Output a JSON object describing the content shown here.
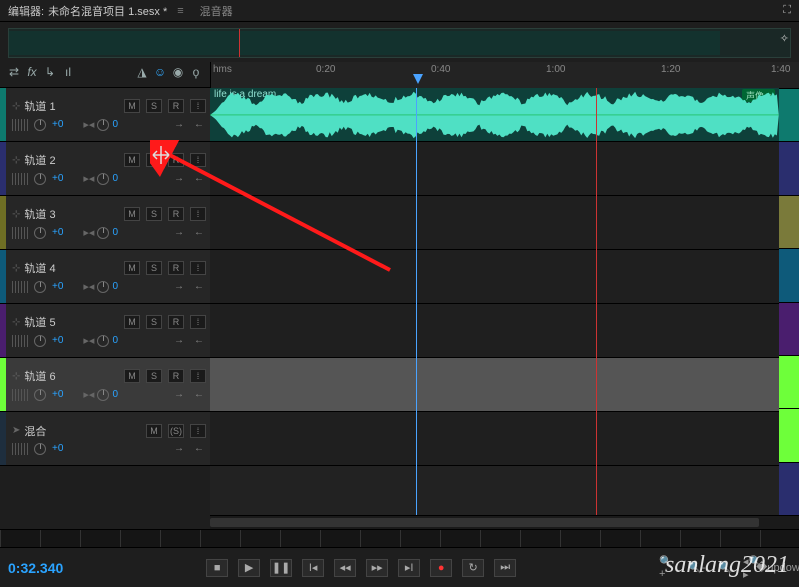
{
  "titlebar": {
    "editor_label": "编辑器:",
    "project_name": "未命名混音项目 1.sesx *",
    "mixer_tab": "混音器"
  },
  "overview": {
    "playhead_pct": 29
  },
  "ruler": {
    "unit": "hms",
    "labels": [
      "0:20",
      "0:40",
      "1:00",
      "1:20",
      "1:40"
    ]
  },
  "tracks": [
    {
      "name": "轨道 1",
      "color": "#0e7a6e",
      "vol": "+0",
      "pan": "0",
      "msr": [
        "M",
        "S",
        "R"
      ],
      "mix": false
    },
    {
      "name": "轨道 2",
      "color": "#2a2e6e",
      "vol": "+0",
      "pan": "0",
      "msr": [
        "M",
        "S",
        "R"
      ],
      "mix": false
    },
    {
      "name": "轨道 3",
      "color": "#6e6e24",
      "vol": "+0",
      "pan": "0",
      "msr": [
        "M",
        "S",
        "R"
      ],
      "mix": false
    },
    {
      "name": "轨道 4",
      "color": "#0e5a7a",
      "vol": "+0",
      "pan": "0",
      "msr": [
        "M",
        "S",
        "R"
      ],
      "mix": false
    },
    {
      "name": "轨道 5",
      "color": "#4a1e6e",
      "vol": "+0",
      "pan": "0",
      "msr": [
        "M",
        "S",
        "R"
      ],
      "mix": false
    },
    {
      "name": "轨道 6",
      "color": "#6eff3a",
      "vol": "+0",
      "pan": "0",
      "msr": [
        "M",
        "S",
        "R"
      ],
      "mix": false,
      "selected": true
    },
    {
      "name": "混合",
      "color": "#1e2e3e",
      "vol": "+0",
      "pan": "",
      "msr": [
        "M",
        "(S)"
      ],
      "mix": true
    }
  ],
  "clip": {
    "name": "life is a dream",
    "pill": "声像 ▾"
  },
  "channel_colors": [
    "#0e7a6e",
    "#2a2e6e",
    "#7a7a3a",
    "#0e5a7a",
    "#4a1e6e",
    "#6eff3a",
    "#6eff3a",
    "#2a2e6e"
  ],
  "transport": {
    "timecode": "0:32.340"
  },
  "watermark": "sanlang2021"
}
